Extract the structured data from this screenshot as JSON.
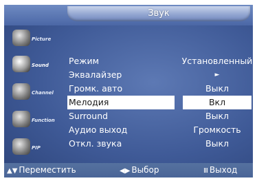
{
  "title": "Звук",
  "sidebar": {
    "items": [
      {
        "label": "Picture",
        "icon": "picture-icon"
      },
      {
        "label": "Sound",
        "icon": "sound-icon",
        "active": true
      },
      {
        "label": "Channel",
        "icon": "channel-icon"
      },
      {
        "label": "Function",
        "icon": "function-icon"
      },
      {
        "label": "PIP",
        "icon": "pip-icon"
      }
    ]
  },
  "menu": {
    "rows": [
      {
        "label": "Режим",
        "value": "Установленный"
      },
      {
        "label": "Эквалайзер",
        "value": "►"
      },
      {
        "label": "Громк. авто",
        "value": "Выкл"
      },
      {
        "label": "Мелодия",
        "value": "Вкл",
        "selected": true
      },
      {
        "label": "Surround",
        "value": "Выкл"
      },
      {
        "label": "Аудио выход",
        "value": "Громкость"
      },
      {
        "label": "Откл. звука",
        "value": "Выкл"
      }
    ]
  },
  "footer": {
    "move_icon": "▲▼",
    "move_label": "Переместить",
    "select_icon": "◀▶",
    "select_label": "Выбор",
    "exit_icon": "Ⅲ",
    "exit_label": "Выход"
  }
}
